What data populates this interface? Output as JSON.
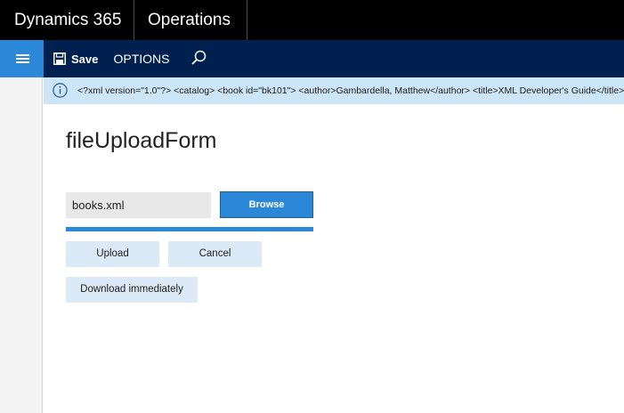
{
  "header": {
    "app_name": "Dynamics 365",
    "module_name": "Operations"
  },
  "actionbar": {
    "save_label": "Save",
    "options_label": "OPTIONS",
    "icons": {
      "nav": "hamburger-icon",
      "save": "save-icon",
      "search": "search-icon"
    }
  },
  "info_bar": {
    "icon": "info-icon",
    "message": "<?xml version=\"1.0\"?> <catalog> <book id=\"bk101\"> <author>Gambardella, Matthew</author> <title>XML Developer's Guide</title>"
  },
  "form": {
    "title": "fileUploadForm",
    "file_value": "books.xml",
    "browse_label": "Browse",
    "upload_progress": 1.0,
    "upload_label": "Upload",
    "cancel_label": "Cancel",
    "download_label": "Download immediately"
  },
  "colors": {
    "accent": "#2b88d8",
    "nav_dark": "#002050",
    "top_bar": "#000000",
    "info_bg": "#cde6f7",
    "button_light": "#dce9f7"
  }
}
